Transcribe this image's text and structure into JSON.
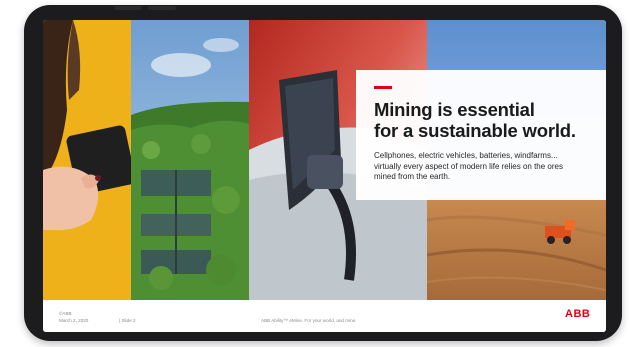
{
  "slide": {
    "headline_line1": "Mining is essential",
    "headline_line2": "for a sustainable world.",
    "body_line1": "Cellphones, electric vehicles, batteries, windfarms...",
    "body_line2": "virtually every aspect of modern life relies on the ores",
    "body_line3": "mined from the earth."
  },
  "footer": {
    "company": "©ABB",
    "date": "March 2, 2020",
    "slide_number": "| Slide 2",
    "tagline": "ABB Ability™ eMine. For your world, and mine.",
    "logo": "ABB"
  },
  "colors": {
    "accent": "#e2000f",
    "logo": "#e2000f"
  }
}
